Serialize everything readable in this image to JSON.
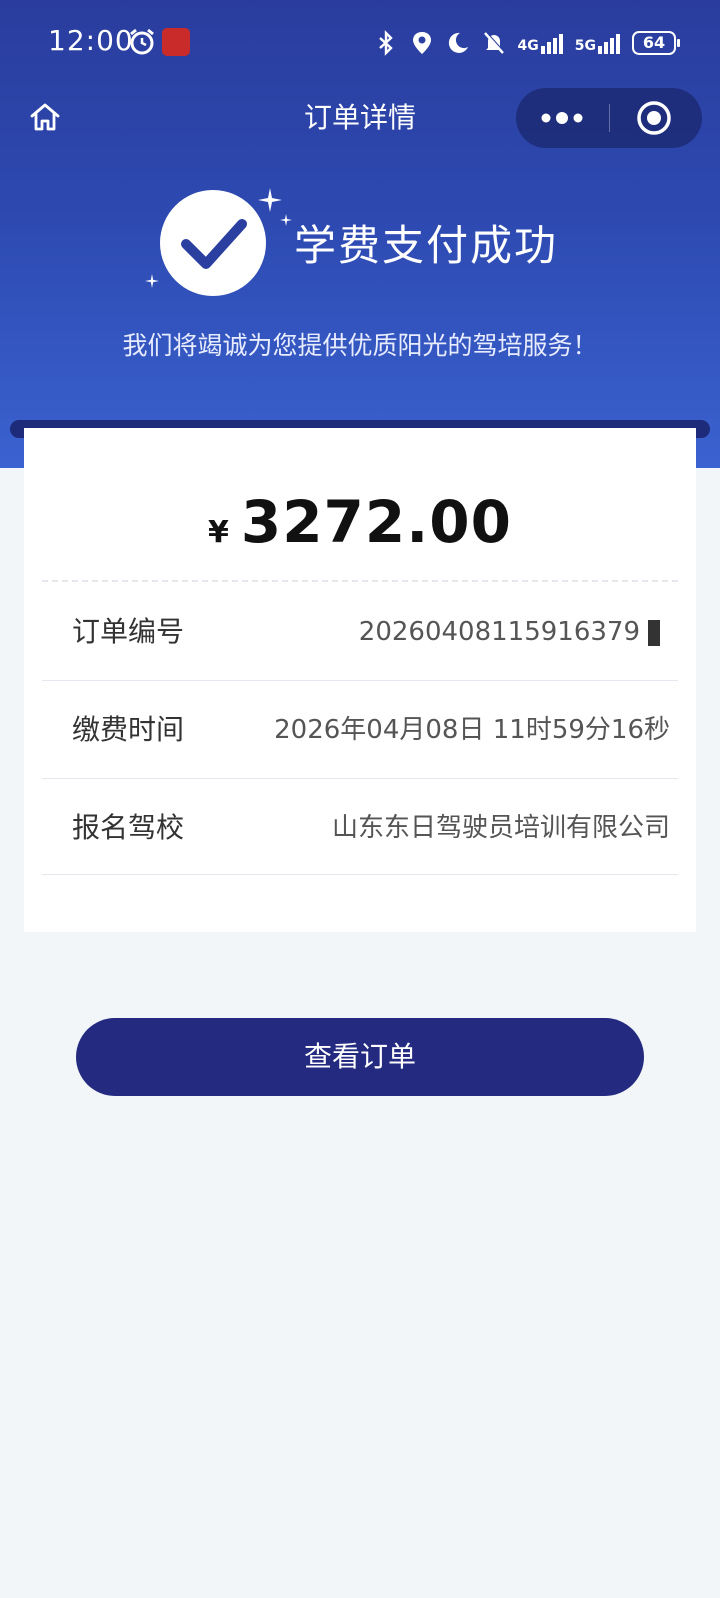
{
  "status_bar": {
    "time": "12:00",
    "network_1": "4G",
    "network_2": "5G",
    "battery": "64"
  },
  "nav": {
    "title": "订单详情"
  },
  "success": {
    "title": "学费支付成功",
    "subtitle": "我们将竭诚为您提供优质阳光的驾培服务！"
  },
  "order": {
    "currency_symbol": "¥",
    "amount": "3272.00",
    "rows": [
      {
        "label": "订单编号",
        "value": "2026040811591637​9"
      },
      {
        "label": "缴费时间",
        "value": "2026年04月08日 11时59分16秒"
      },
      {
        "label": "报名驾校",
        "value": "山东东日驾驶员培训有限公司"
      }
    ]
  },
  "actions": {
    "view_order_label": "查看订单"
  },
  "colors": {
    "header_gradient_top": "#2a3d9e",
    "header_gradient_bottom": "#3a62d0",
    "button": "#232a80",
    "page_background": "#f2f6f8"
  },
  "icons": [
    "alarm-icon",
    "app-badge-icon",
    "bluetooth-icon",
    "location-icon",
    "moon-icon",
    "mute-icon",
    "home-icon",
    "more-icon",
    "close-target-icon",
    "check-icon",
    "sparkle-icon"
  ]
}
